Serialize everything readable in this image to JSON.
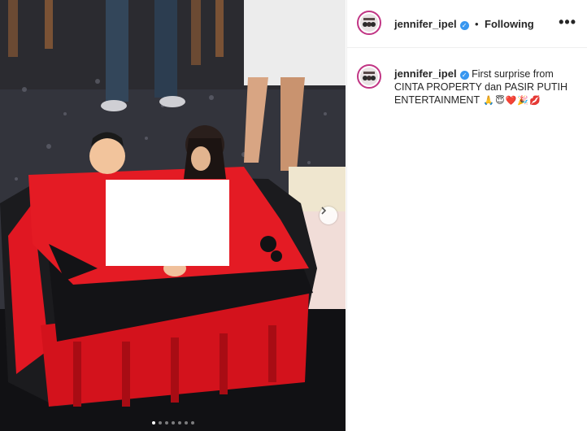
{
  "post": {
    "username": "jennifer_ipel",
    "separator": "•",
    "follow_status": "Following",
    "more_label": "•••",
    "caption": {
      "username": "jennifer_ipel",
      "text_line": "First surprise from CINTA PROPERTY dan PASIR PUTIH ENTERTAINMENT",
      "emojis": [
        "🙏",
        "😇",
        "❤️",
        "🎉",
        "💋"
      ]
    },
    "carousel": {
      "total_slides": 7,
      "active_slide": 1,
      "next_icon": "chevron-right-icon"
    },
    "colors": {
      "verified": "#3897f0",
      "avatar_ring": "#c13584",
      "border": "#efefef"
    }
  }
}
